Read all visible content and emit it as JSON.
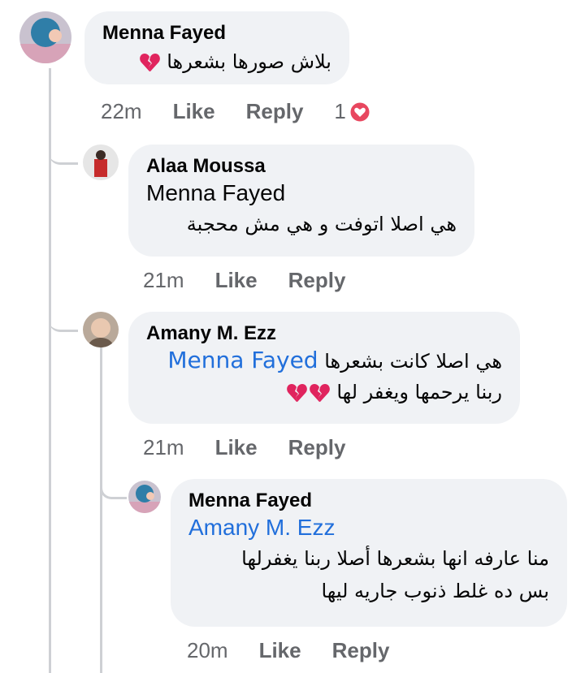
{
  "comments": [
    {
      "author": "Menna Fayed",
      "text": "بلاش صورها بشعرها",
      "broken_hearts": 1,
      "time": "22m",
      "like_label": "Like",
      "reply_label": "Reply",
      "reaction_count": "1",
      "reaction_icon": "heart-reaction-icon"
    },
    {
      "author": "Alaa Moussa",
      "mention": "Menna Fayed",
      "text": "هي اصلا اتوفت و هي مش محجبة",
      "time": "21m",
      "like_label": "Like",
      "reply_label": "Reply"
    },
    {
      "author": "Amany M. Ezz",
      "mention": "Menna Fayed",
      "text_line1": "هي اصلا كانت بشعرها",
      "text_line2": "ربنا يرحمها ويغفر لها",
      "broken_hearts": 2,
      "time": "21m",
      "like_label": "Like",
      "reply_label": "Reply"
    },
    {
      "author": "Menna Fayed",
      "mention": "Amany M. Ezz",
      "text_line1": "منا عارفه انها بشعرها أصلا ربنا يغفرلها",
      "text_line2": "بس ده غلط  ذنوب جاريه ليها",
      "time": "20m",
      "like_label": "Like",
      "reply_label": "Reply"
    }
  ],
  "colors": {
    "bubble": "#f0f2f5",
    "link": "#216fdb",
    "meta": "#65676b",
    "reaction": "#e8475f",
    "broken_heart": "#e0245e"
  }
}
